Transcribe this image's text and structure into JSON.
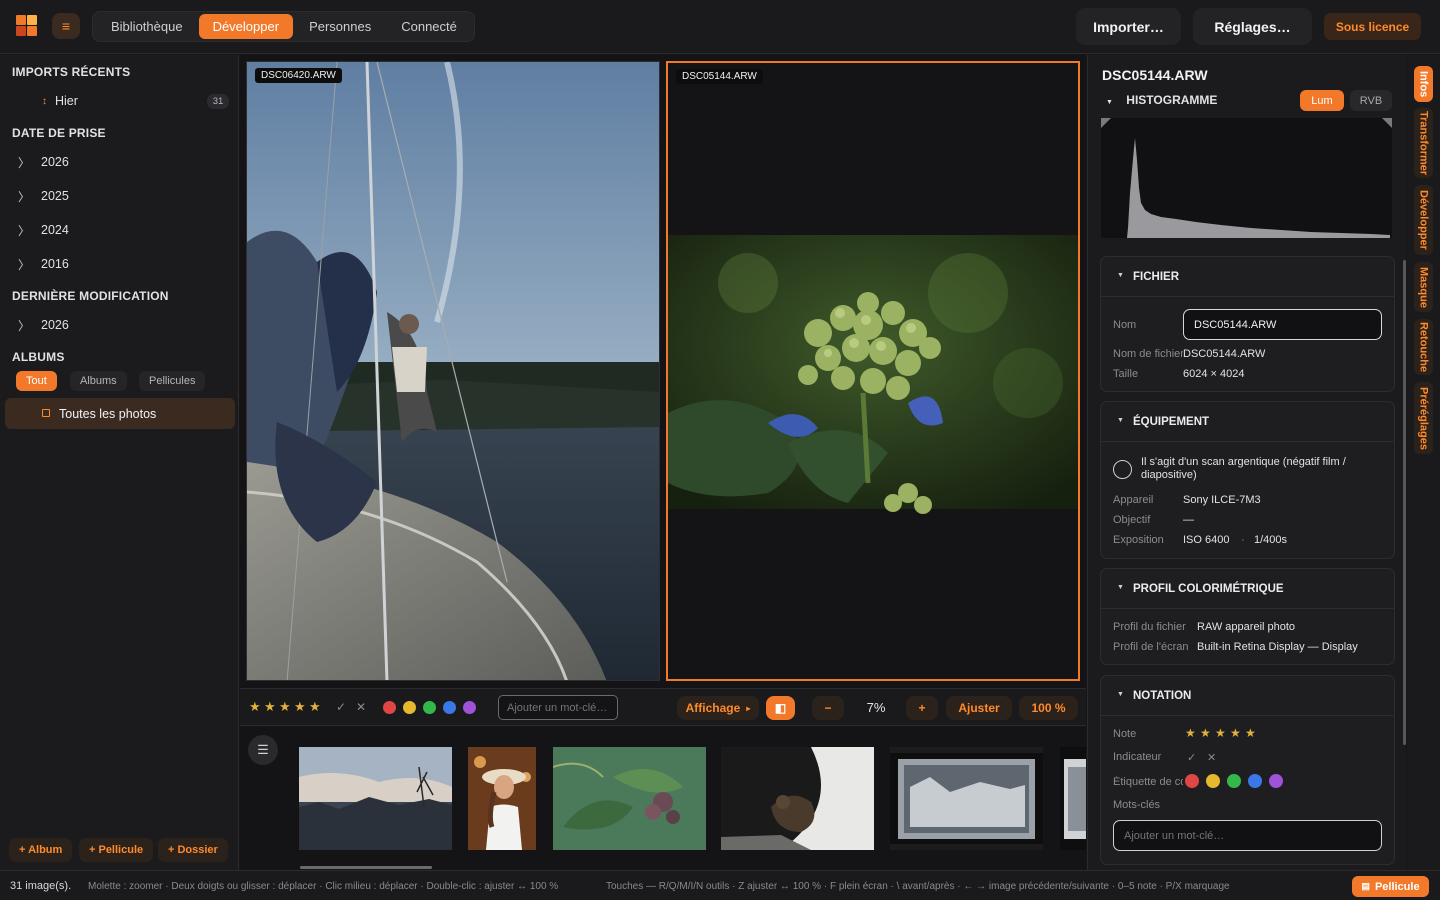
{
  "header": {
    "menu_icon": "hamburger-menu-icon",
    "tabs": [
      {
        "label": "Bibliothèque",
        "active": false
      },
      {
        "label": "Développer",
        "active": true
      },
      {
        "label": "Personnes",
        "active": false
      },
      {
        "label": "Connecté",
        "active": false
      }
    ],
    "import_label": "Importer…",
    "settings_label": "Réglages…",
    "licence_label": "Sous licence",
    "accent_color": "#f2792a"
  },
  "sidebar": {
    "recent_imports": {
      "heading": "IMPORTS RÉCENTS",
      "items": [
        {
          "label": "Hier",
          "count": "31"
        }
      ]
    },
    "capture_date": {
      "heading": "DATE DE PRISE",
      "years": [
        "2026",
        "2025",
        "2024",
        "2016"
      ]
    },
    "last_modified": {
      "heading": "DERNIÈRE MODIFICATION",
      "years": [
        "2026"
      ]
    },
    "albums": {
      "heading": "ALBUMS",
      "filters": [
        "Tout",
        "Albums",
        "Pellicules"
      ],
      "active_filter": "Tout",
      "all_photos_label": "Toutes les photos"
    },
    "actions": {
      "album": "+ Album",
      "pellicule": "+ Pellicule",
      "dossier": "+ Dossier"
    }
  },
  "viewer": {
    "left_label": "DSC06420.ARW",
    "right_label": "DSC05144.ARW"
  },
  "viewbar": {
    "rating_stars": 5,
    "flag_pick_icon": "check-icon",
    "flag_reject_icon": "x-icon",
    "color_labels": [
      "#e04646",
      "#e6b82e",
      "#35b84a",
      "#3b78e7",
      "#a052d8"
    ],
    "keyword_placeholder": "Ajouter un mot-clé…",
    "display_label": "Affichage",
    "display_chevron": "▸",
    "compare_icon": "compare-icon",
    "zoom_out": "−",
    "zoom_value": "7%",
    "zoom_in": "+",
    "fit_label": "Ajuster",
    "full_label": "100 %"
  },
  "filmstrip": {
    "toggle_icon": "filmstrip-toggle-icon",
    "thumbs": [
      "thumb-sunset-city",
      "thumb-woman-hat",
      "thumb-leaves",
      "thumb-otter",
      "thumb-film-negative",
      "thumb-film-partial"
    ]
  },
  "inspector": {
    "file_title": "DSC05144.ARW",
    "histogram": {
      "heading": "HISTOGRAMME",
      "modes": [
        "Lum",
        "RVB"
      ],
      "active_mode": "Lum"
    },
    "fichier": {
      "heading": "FICHIER",
      "name_label": "Nom",
      "name_value": "DSC05144.ARW",
      "filename_label": "Nom de fichier",
      "filename_value": "DSC05144.ARW",
      "size_label": "Taille",
      "size_value": "6024 × 4024"
    },
    "equipement": {
      "heading": "ÉQUIPEMENT",
      "film_scan_label": "Il s'agit d'un scan argentique (négatif film / diapositive)",
      "camera_label": "Appareil",
      "camera_value": "Sony ILCE-7M3",
      "lens_label": "Objectif",
      "lens_value": "—",
      "exposure_label": "Exposition",
      "iso_value": "ISO 6400",
      "separator": "·",
      "shutter_value": "1/400s"
    },
    "profil": {
      "heading": "PROFIL COLORIMÉTRIQUE",
      "file_profile_label": "Profil du fichier",
      "file_profile_value": "RAW appareil photo",
      "screen_profile_label": "Profil de l'écran",
      "screen_profile_value": "Built-in Retina Display — Display"
    },
    "notation": {
      "heading": "NOTATION",
      "rating_label": "Note",
      "rating_stars": 5,
      "flag_label": "Indicateur",
      "color_label": "Étiquette de couleur",
      "colors": [
        "#e04646",
        "#e6b82e",
        "#35b84a",
        "#3b78e7",
        "#a052d8"
      ],
      "keywords_label": "Mots-clés",
      "keyword_placeholder": "Ajouter un mot-clé…"
    }
  },
  "vertical_tabs": [
    {
      "label": "Infos",
      "active": true
    },
    {
      "label": "Transformer",
      "active": false
    },
    {
      "label": "Développer",
      "active": false
    },
    {
      "label": "Masque",
      "active": false
    },
    {
      "label": "Retouche",
      "active": false
    },
    {
      "label": "Préréglages",
      "active": false
    }
  ],
  "statusbar": {
    "image_count": "31 image(s).",
    "mouse_hint": "Molette : zoomer · Deux doigts ou glisser : déplacer · Clic milieu : déplacer · Double-clic : ajuster ↔ 100 %",
    "keys_hint": "Touches — R/Q/M/I/N outils · Z ajuster ↔ 100 % · F plein écran · \\ avant/après · ← → image précédente/suivante · 0–5 note · P/X marquage",
    "pellicule_label": "Pellicule"
  }
}
